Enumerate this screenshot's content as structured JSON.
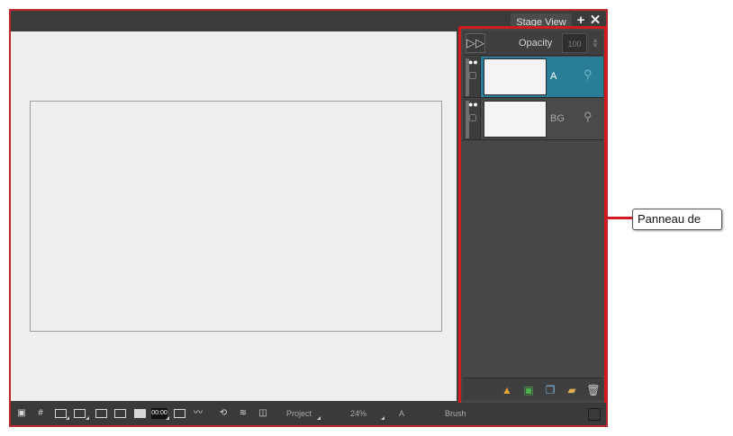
{
  "window": {
    "tab_label": "Stage View",
    "add_icon": "plus-icon",
    "close_icon": "close-icon"
  },
  "layers_panel": {
    "expand_icon": "double-chevron-right-icon",
    "opacity_label": "Opacity",
    "opacity_value": "100",
    "layers": [
      {
        "name": "A",
        "selected": true
      },
      {
        "name": "BG",
        "selected": false
      }
    ],
    "footer_buttons": [
      "add-layer-icon",
      "add-drawing-layer-icon",
      "add-group-icon",
      "add-folder-icon",
      "trash-icon"
    ]
  },
  "status_bar": {
    "project_label": "Project",
    "zoom_value": "24%",
    "layer_value": "A",
    "tool_label": "Brush"
  },
  "callout": {
    "text": "Panneau de"
  },
  "colors": {
    "highlight": "#d21a20",
    "selected_layer": "#2a7d96",
    "canvas": "#efefef"
  }
}
